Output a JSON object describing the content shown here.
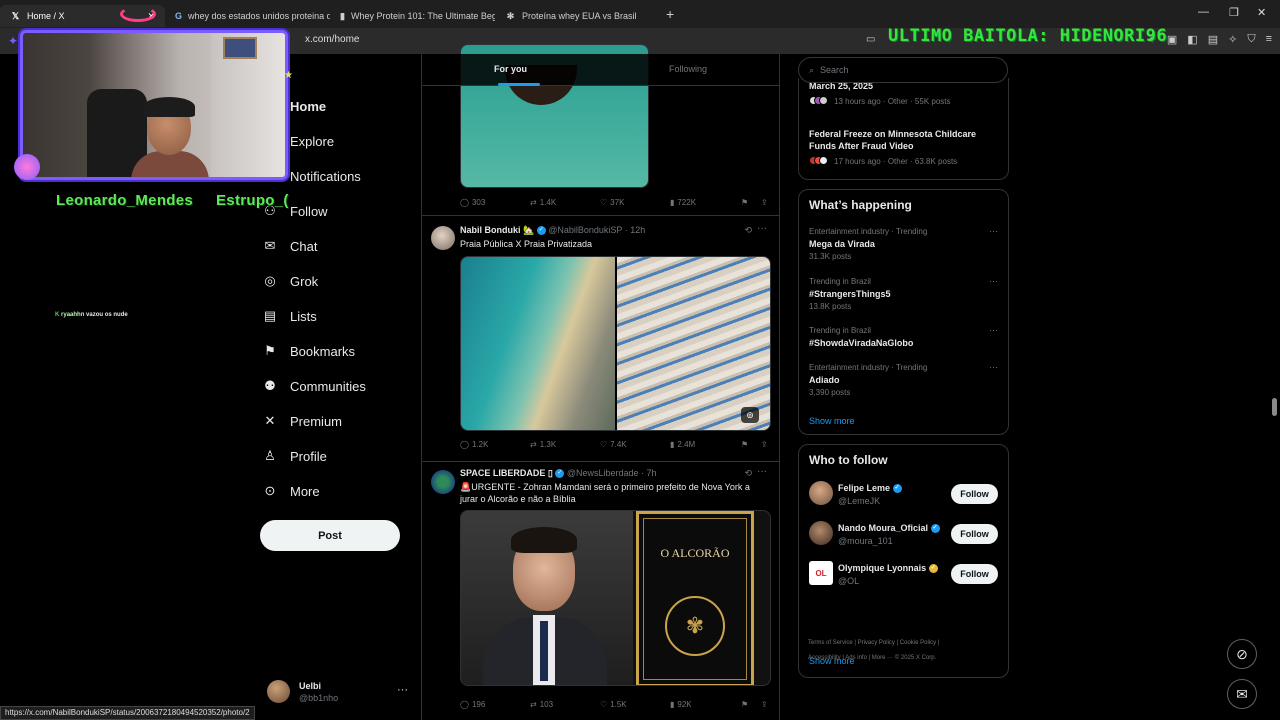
{
  "browser": {
    "tabs": [
      {
        "title": "Home / X",
        "icon": "x-icon"
      },
      {
        "title": "whey dos estados unidos proteina q",
        "icon": "google-icon"
      },
      {
        "title": "Whey Protein 101: The Ultimate Beg",
        "icon": "bookmark-icon"
      },
      {
        "title": "Proteína whey EUA vs Brasil",
        "icon": "chatgpt-icon"
      }
    ],
    "url": "x.com/home",
    "status_url": "https://x.com/NabilBondukiSP/status/2006372180494520352/photo/2"
  },
  "overlay": {
    "banner": "ULTIMO BAITOLA: HIDENORI96",
    "stream_name_1": "Leonardo_Mendes",
    "stream_name_2": "Estrupo_(",
    "chat_user": "ryaahhn",
    "chat_msg": "vazou os nude"
  },
  "nav": {
    "items": [
      {
        "label": "Home",
        "icon": "home-icon",
        "glyph": "⌂"
      },
      {
        "label": "Explore",
        "icon": "search-icon",
        "glyph": "⌕"
      },
      {
        "label": "Notifications",
        "icon": "bell-icon",
        "glyph": "♫"
      },
      {
        "label": "Follow",
        "icon": "follow-icon",
        "glyph": "⚇"
      },
      {
        "label": "Chat",
        "icon": "mail-icon",
        "glyph": "✉"
      },
      {
        "label": "Grok",
        "icon": "grok-icon",
        "glyph": "◎"
      },
      {
        "label": "Lists",
        "icon": "list-icon",
        "glyph": "▤"
      },
      {
        "label": "Bookmarks",
        "icon": "bookmark-icon",
        "glyph": "⚑"
      },
      {
        "label": "Communities",
        "icon": "communities-icon",
        "glyph": "⚉"
      },
      {
        "label": "Premium",
        "icon": "x-logo-icon",
        "glyph": "✕"
      },
      {
        "label": "Profile",
        "icon": "profile-icon",
        "glyph": "♙"
      },
      {
        "label": "More",
        "icon": "more-circle-icon",
        "glyph": "⊙"
      }
    ],
    "post_label": "Post",
    "account": {
      "name": "Uelbi",
      "handle": "@bb1nho"
    }
  },
  "feed": {
    "tabs": [
      "For you",
      "Following"
    ],
    "tweets": [
      {
        "actions": {
          "replies": "303",
          "reposts": "1.4K",
          "likes": "37K",
          "views": "722K"
        }
      },
      {
        "name": "Nabil Bonduki 🏡",
        "handle": "@NabilBondukiSP",
        "time": "12h",
        "text": "Praia Pública X Praia Privatizada",
        "actions": {
          "replies": "1.2K",
          "reposts": "1.3K",
          "likes": "7.4K",
          "views": "2.4M"
        }
      },
      {
        "name": "SPACE LIBERDADE ▯",
        "handle": "@NewsLiberdade",
        "time": "7h",
        "text": "🚨URGENTE - Zohran Mamdani será o primeiro prefeito de Nova York a jurar o Alcorão e não a Bíblia",
        "media_text": "O ALCORÃO",
        "actions": {
          "replies": "196",
          "reposts": "103",
          "likes": "1.5K",
          "views": "92K"
        }
      }
    ]
  },
  "sidebar": {
    "search_placeholder": "Search",
    "news": [
      {
        "title": "March 25, 2025",
        "meta": "13 hours ago · Other · 55K posts"
      },
      {
        "title": "Federal Freeze on Minnesota Childcare Funds After Fraud Video",
        "meta": "17 hours ago · Other · 63.8K posts"
      }
    ],
    "happening_title": "What’s happening",
    "trends": [
      {
        "context": "Entertainment industry · Trending",
        "name": "Mega da Virada",
        "posts": "31.3K posts"
      },
      {
        "context": "Trending in Brazil",
        "name": "#StrangersThings5",
        "posts": "13.8K posts"
      },
      {
        "context": "Trending in Brazil",
        "name": "#ShowdaViradaNaGlobo",
        "posts": ""
      },
      {
        "context": "Entertainment industry · Trending",
        "name": "Adiado",
        "posts": "3,390 posts"
      }
    ],
    "show_more": "Show more",
    "wtf_title": "Who to follow",
    "follow_label": "Follow",
    "who_to_follow": [
      {
        "name": "Felipe Leme",
        "handle": "@LemeJK",
        "badge": "blue"
      },
      {
        "name": "Nando Moura_Oficial",
        "handle": "@moura_101",
        "badge": "blue"
      },
      {
        "name": "Olympique Lyonnais",
        "handle": "@OL",
        "badge": "gold"
      }
    ],
    "footer_line1": "Terms of Service   |   Privacy Policy   |   Cookie Policy   |",
    "footer_line2": "Accessibility   |   Ads info   |   More ···   © 2025 X Corp."
  },
  "colors": {
    "accent": "#1d9bf0",
    "overlay_green": "#5fe85a",
    "webcam_border": "#7a5cff"
  }
}
